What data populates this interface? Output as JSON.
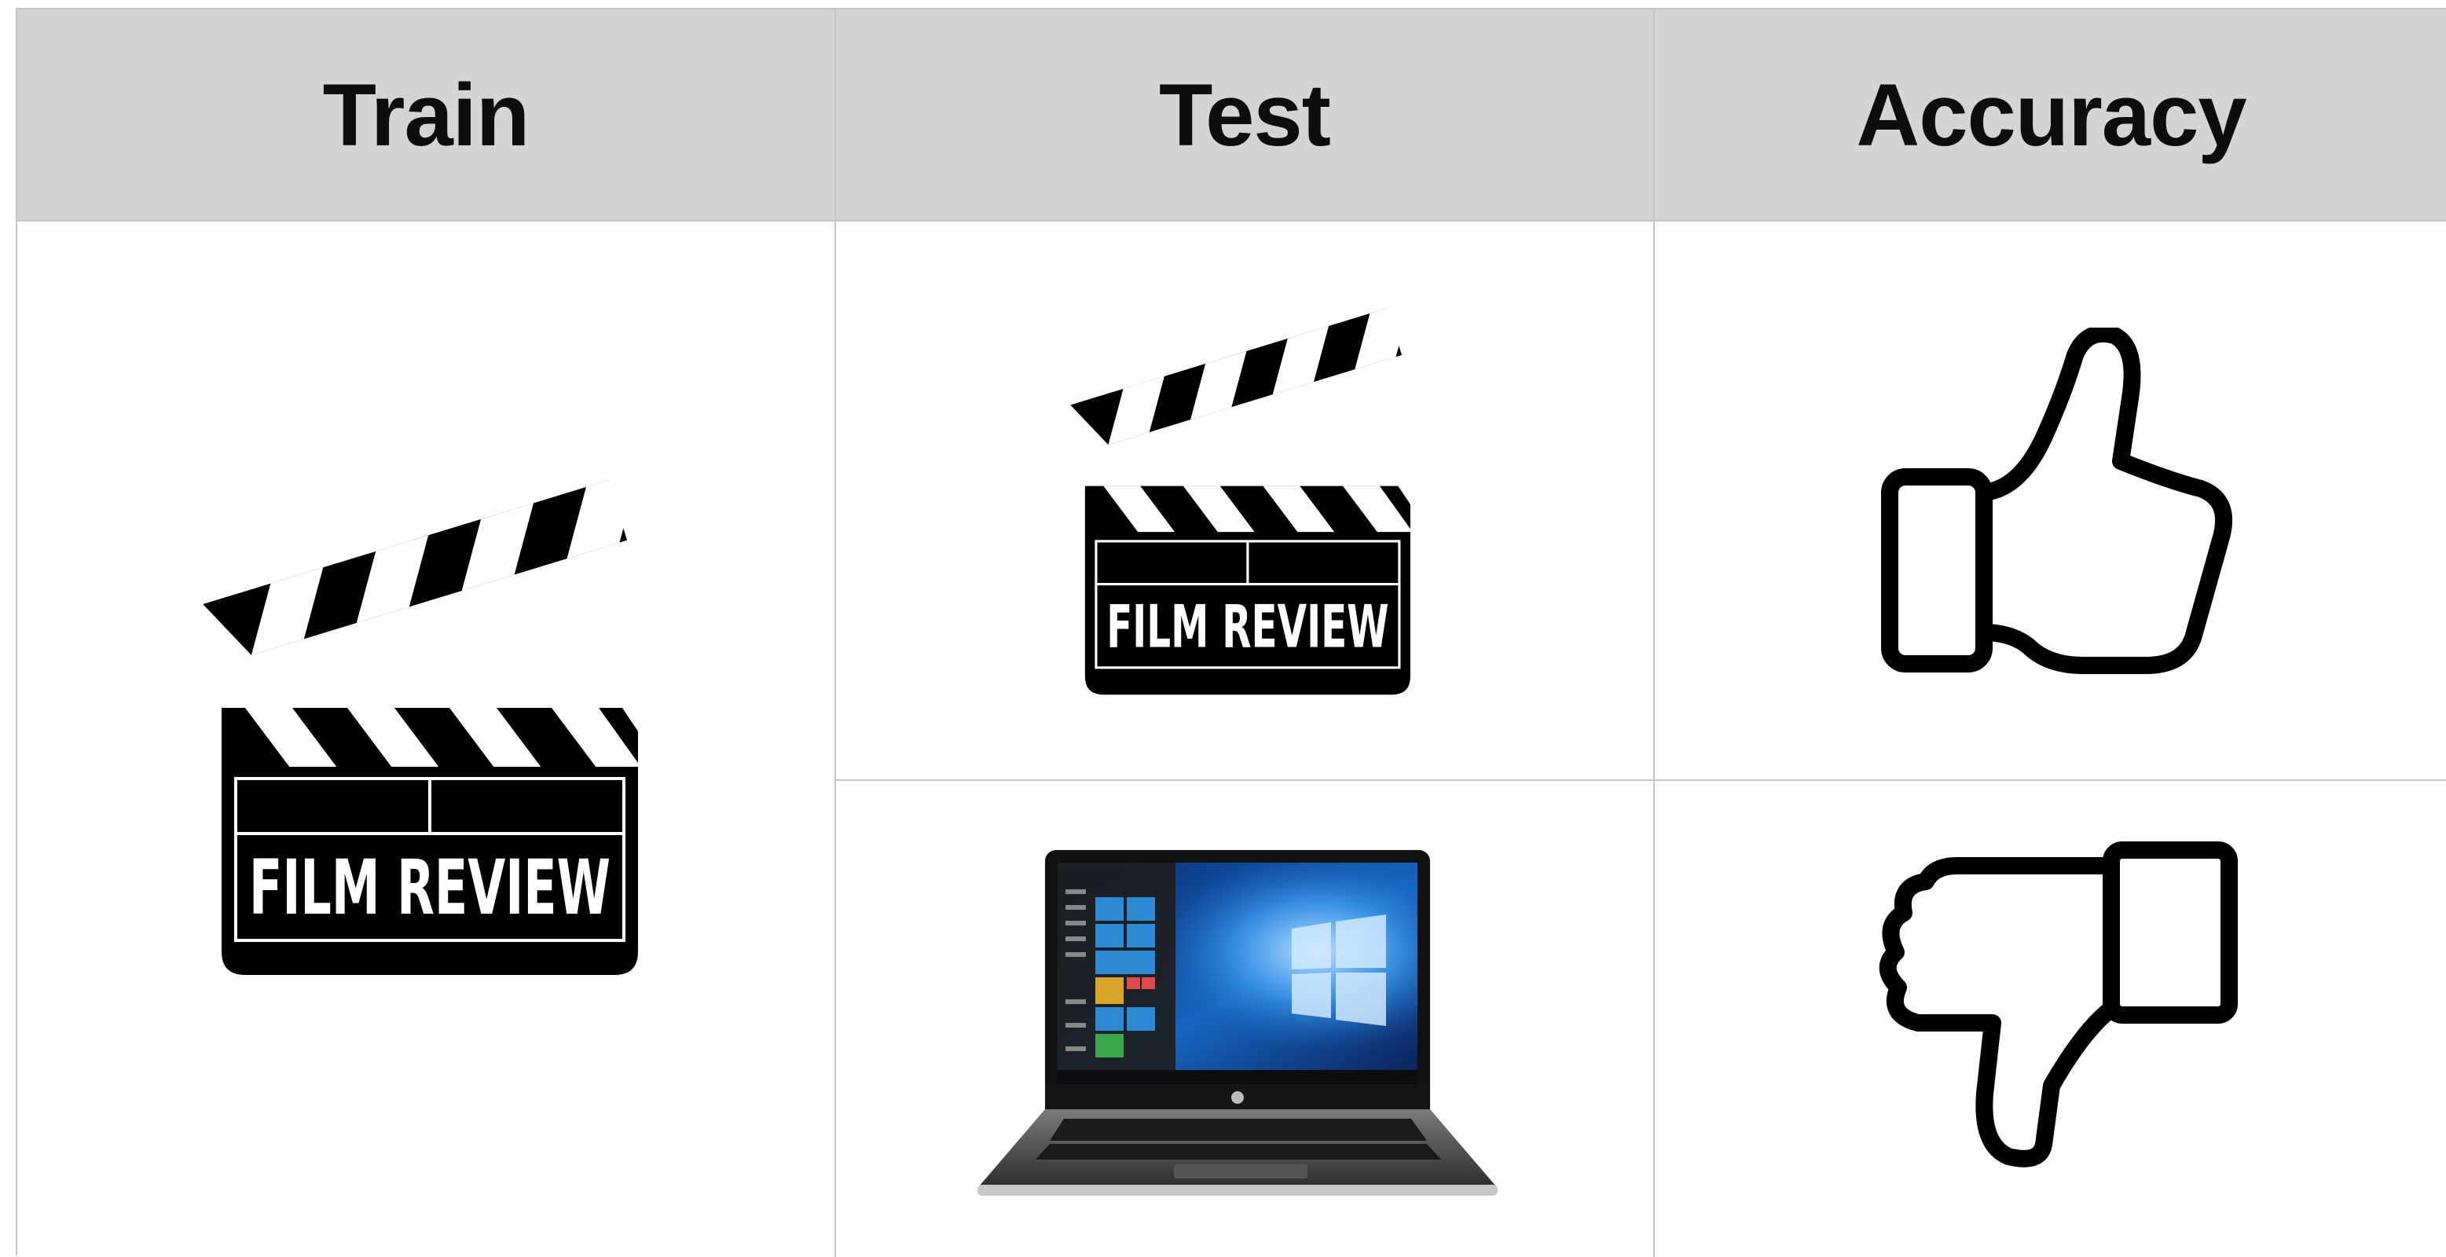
{
  "headers": {
    "train": "Train",
    "test": "Test",
    "accuracy": "Accuracy"
  },
  "train": {
    "icon": "film-review-clapperboard-icon",
    "label": "FILM REVIEW"
  },
  "test": [
    {
      "icon": "film-review-clapperboard-icon",
      "label": "FILM REVIEW"
    },
    {
      "icon": "laptop-icon"
    }
  ],
  "accuracy": [
    {
      "icon": "thumbs-up-icon"
    },
    {
      "icon": "thumbs-down-icon"
    }
  ],
  "colors": {
    "header_bg": "#d4d4d4",
    "grid_line": "#c4c4c4",
    "icon": "#000000"
  }
}
